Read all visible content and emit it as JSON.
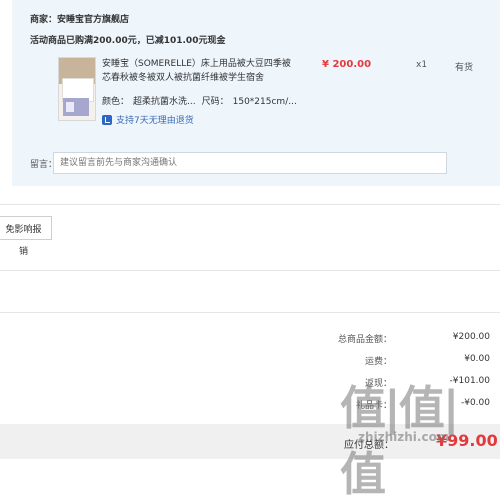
{
  "order": {
    "merchant": "商家：安睡宝官方旗舰店",
    "promo": "活动商品已购满200.00元，已减101.00元现金",
    "product": {
      "title": "安睡宝（SOMERELLE）床上用品被大豆四季被芯春秋被冬被双人被抗菌纤维被学生宿舍",
      "spec_color_label": "颜色：",
      "spec_color_value": "超柔抗菌水洗...",
      "spec_size_label": "尺码：",
      "spec_size_value": "150*215cm/...",
      "return_policy": "支持7天无理由退货",
      "price": "¥ 200.00",
      "quantity": "x1",
      "stock": "有货"
    },
    "note": {
      "label": "留言：",
      "placeholder": "建议留言前先与商家沟通确认"
    }
  },
  "ad_button_label": "免影响报销",
  "summary": {
    "total_label": "总商品金额：",
    "total_value": "¥200.00",
    "shipping_label": "运费：",
    "shipping_value": "¥0.00",
    "discount_label": "返现：",
    "discount_value": "-¥101.00",
    "other_label": "礼品卡：",
    "other_value": "-¥0.00"
  },
  "footer": {
    "pay_label": "应付总额：",
    "pay_value": "¥99.00"
  },
  "watermark": {
    "main": "值|值|值",
    "sub": "zhizhizhi.com"
  }
}
